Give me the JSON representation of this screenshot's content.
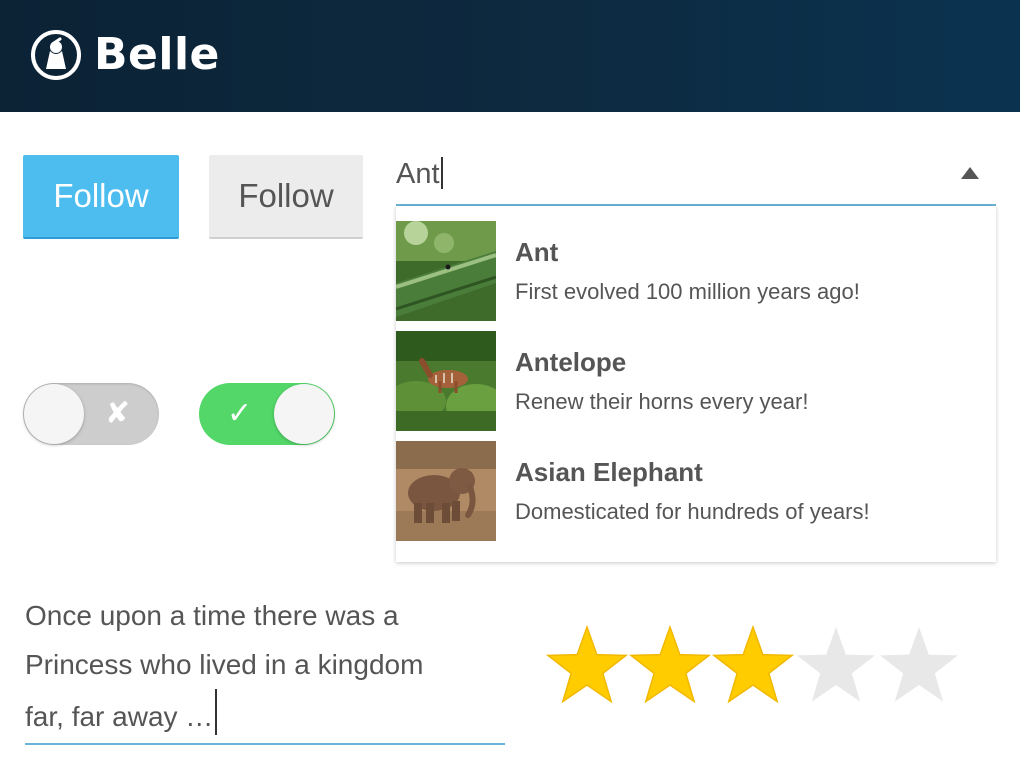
{
  "header": {
    "brand": "Belle",
    "background": "#0c2235"
  },
  "buttons": {
    "primary_label": "Follow",
    "default_label": "Follow",
    "primary_color": "#4dbdef"
  },
  "toggles": [
    {
      "state": "off",
      "glyph": "✘"
    },
    {
      "state": "on",
      "glyph": "✓",
      "color": "#53d769"
    }
  ],
  "combobox": {
    "value": "Ant",
    "arrow_icon": "triangle-up-icon",
    "options": [
      {
        "title": "Ant",
        "description": "First evolved 100 million years ago!",
        "image": "ant-photo"
      },
      {
        "title": "Antelope",
        "description": "Renew their horns every year!",
        "image": "antelope-photo"
      },
      {
        "title": "Asian Elephant",
        "description": "Domesticated for hundreds of years!",
        "image": "elephant-photo"
      }
    ]
  },
  "textarea": {
    "lines": [
      "Once upon a time there was a",
      "Princess who lived in a kingdom",
      "far, far away …"
    ]
  },
  "rating": {
    "value": 3,
    "max": 5,
    "filled_color": "#ffcc00",
    "empty_color": "#e8e8e8"
  }
}
